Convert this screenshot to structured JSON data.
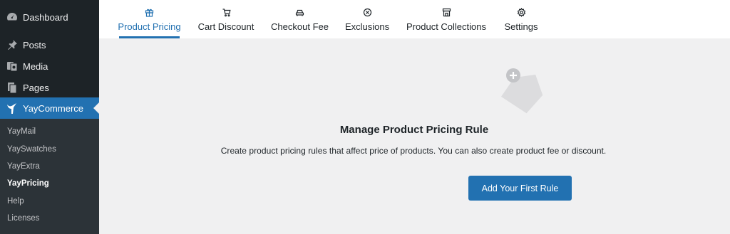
{
  "sidebar": {
    "menu": [
      {
        "label": "Dashboard",
        "icon": "dashboard-icon"
      },
      {
        "label": "Posts",
        "icon": "pin-icon"
      },
      {
        "label": "Media",
        "icon": "media-icon"
      },
      {
        "label": "Pages",
        "icon": "pages-icon"
      },
      {
        "label": "YayCommerce",
        "icon": "yaycommerce-icon",
        "active": true
      }
    ],
    "submenu": [
      {
        "label": "YayMail"
      },
      {
        "label": "YaySwatches"
      },
      {
        "label": "YayExtra"
      },
      {
        "label": "YayPricing",
        "current": true
      },
      {
        "label": "Help"
      },
      {
        "label": "Licenses"
      }
    ]
  },
  "tabs": [
    {
      "label": "Product Pricing",
      "icon": "gift-icon",
      "active": true
    },
    {
      "label": "Cart Discount",
      "icon": "cart-icon"
    },
    {
      "label": "Checkout Fee",
      "icon": "car-icon"
    },
    {
      "label": "Exclusions",
      "icon": "circle-x-icon"
    },
    {
      "label": "Product Collections",
      "icon": "store-icon"
    },
    {
      "label": "Settings",
      "icon": "gear-icon"
    }
  ],
  "empty_state": {
    "title": "Manage Product Pricing Rule",
    "description": "Create product pricing rules that affect price of products. You can also create product fee or discount.",
    "button_label": "Add Your First Rule"
  },
  "colors": {
    "accent": "#2271b1",
    "sidebar_bg": "#1d2327",
    "submenu_bg": "#2c3338",
    "content_bg": "#f0f0f1"
  }
}
